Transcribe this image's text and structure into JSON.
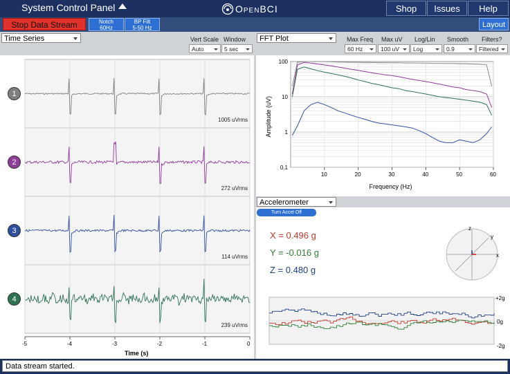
{
  "topbar": {
    "panel_title": "System Control Panel",
    "brand": "OpenBCI",
    "shop": "Shop",
    "issues": "Issues",
    "help": "Help"
  },
  "toolbar": {
    "stop_stream": "Stop Data Stream",
    "notch_line1": "Notch",
    "notch_line2": "60Hz",
    "bp_line1": "BP Filt",
    "bp_line2": "5-50 Hz",
    "layout": "Layout"
  },
  "time_series": {
    "title": "Time Series",
    "vert_scale_label": "Vert Scale",
    "window_label": "Window",
    "vert_scale_value": "Auto",
    "window_value": "5 sec",
    "xlabel": "Time (s)",
    "xticks": [
      "-5",
      "-4",
      "-3",
      "-2",
      "-1",
      "0"
    ],
    "channels": [
      {
        "num": "1",
        "rms": "1005 uVrms",
        "color": "#7f7f7f"
      },
      {
        "num": "2",
        "rms": "272 uVrms",
        "color": "#8e3d99"
      },
      {
        "num": "3",
        "rms": "114 uVrms",
        "color": "#2f4f9f"
      },
      {
        "num": "4",
        "rms": "239 uVrms",
        "color": "#2e7353"
      }
    ]
  },
  "fft": {
    "title": "FFT Plot",
    "max_freq_label": "Max Freq",
    "max_uv_label": "Max uV",
    "log_lin_label": "Log/Lin",
    "smooth_label": "Smooth",
    "filters_label": "Filters?",
    "max_freq_value": "60 Hz",
    "max_uv_value": "100 uV",
    "log_lin_value": "Log",
    "smooth_value": "0.9",
    "filters_value": "Filtered"
  },
  "accelerometer": {
    "title": "Accelerometer",
    "toggle_btn": "Turn Accel Off",
    "x_text": "X = 0.496 g",
    "y_text": "Y = -0.016 g",
    "z_text": "Z = 0.480 g",
    "x_color": "#c0392b",
    "y_color": "#2e7d32",
    "z_color": "#1f3f8a",
    "axis_x": "x",
    "axis_y": "y",
    "axis_z": "z",
    "scale_top": "+2g",
    "scale_mid": "0g",
    "scale_bot": "-2g"
  },
  "status": {
    "message": "Data stream started."
  },
  "chart_data": {
    "type": "line",
    "xlabel": "Frequency (Hz)",
    "ylabel": "Amplitude (uV)",
    "scale": "log",
    "xlim": [
      0,
      60
    ],
    "ylim": [
      0.1,
      100
    ],
    "xticks": [
      10,
      20,
      30,
      40,
      50,
      60
    ],
    "yticks": [
      "100",
      "10",
      "1",
      "0.1"
    ],
    "grid": true,
    "x": [
      0.5,
      2,
      4,
      6,
      8,
      10,
      12,
      14,
      16,
      18,
      20,
      22,
      24,
      26,
      28,
      30,
      32,
      34,
      36,
      38,
      40,
      42,
      44,
      46,
      48,
      50,
      52,
      54,
      56,
      58,
      59.5
    ],
    "series": [
      {
        "color": "#8c8c8c",
        "values": [
          20,
          95,
          110,
          108,
          105,
          100,
          98,
          97,
          96,
          95,
          95,
          94,
          94,
          93,
          93,
          92,
          92,
          91,
          91,
          90,
          90,
          89,
          89,
          88,
          88,
          87,
          86,
          85,
          84,
          80,
          20
        ]
      },
      {
        "color": "#8e3d99",
        "values": [
          12,
          80,
          95,
          90,
          85,
          80,
          75,
          70,
          65,
          60,
          56,
          52,
          48,
          45,
          42,
          40,
          37,
          34,
          31,
          29,
          27,
          25,
          23,
          21,
          19,
          18,
          16,
          15,
          14,
          12,
          5
        ]
      },
      {
        "color": "#2e7353",
        "values": [
          10,
          60,
          70,
          62,
          55,
          50,
          46,
          42,
          38,
          34,
          30,
          27,
          24,
          22,
          20,
          18,
          17,
          15,
          14,
          13,
          12,
          11,
          10,
          9.5,
          9,
          8.5,
          8,
          7.5,
          7,
          6,
          3
        ]
      },
      {
        "color": "#2f4f9f",
        "values": [
          0.8,
          1.5,
          4,
          6,
          7,
          6,
          5,
          4,
          3.5,
          3,
          2.6,
          2.3,
          2,
          1.8,
          1.7,
          1.6,
          1.5,
          1.4,
          1.3,
          1.1,
          0.9,
          0.7,
          0.55,
          0.5,
          0.5,
          0.6,
          0.55,
          0.5,
          0.6,
          0.9,
          1.4
        ]
      }
    ]
  }
}
